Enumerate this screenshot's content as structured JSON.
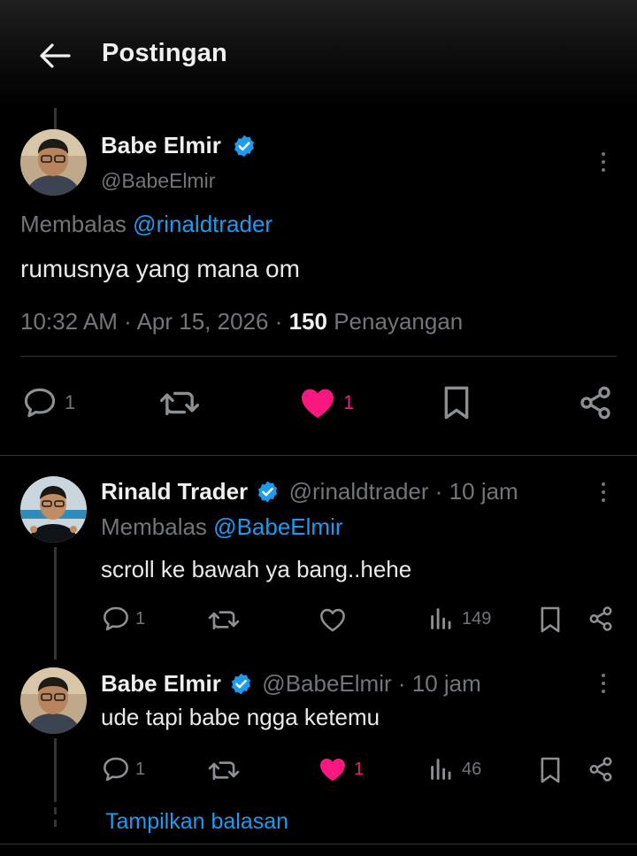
{
  "header": {
    "title": "Postingan"
  },
  "main_post": {
    "author_name": "Babe Elmir",
    "author_handle": "@BabeElmir",
    "replying_prefix": "Membalas",
    "replying_to": "@rinaldtrader",
    "text": "rumusnya yang mana om",
    "time": "10:32 AM",
    "date": "Apr 15, 2026",
    "views_count": "150",
    "views_label": "Penayangan",
    "reply_count": "1",
    "like_count": "1"
  },
  "replies": [
    {
      "author_name": "Rinald Trader",
      "author_handle": "@rinaldtrader",
      "age": "10 jam",
      "replying_prefix": "Membalas",
      "replying_to": "@BabeElmir",
      "text": "scroll ke bawah ya bang..hehe",
      "reply_count": "1",
      "like_count": "",
      "views": "149"
    },
    {
      "author_name": "Babe Elmir",
      "author_handle": "@BabeElmir",
      "age": "10 jam",
      "text": "ude tapi babe ngga ketemu",
      "reply_count": "1",
      "like_count": "1",
      "views": "46"
    }
  ],
  "show_replies": "Tampilkan balasan",
  "colors": {
    "accent": "#1d9bf0",
    "like": "#f91880",
    "muted": "#71767b"
  }
}
